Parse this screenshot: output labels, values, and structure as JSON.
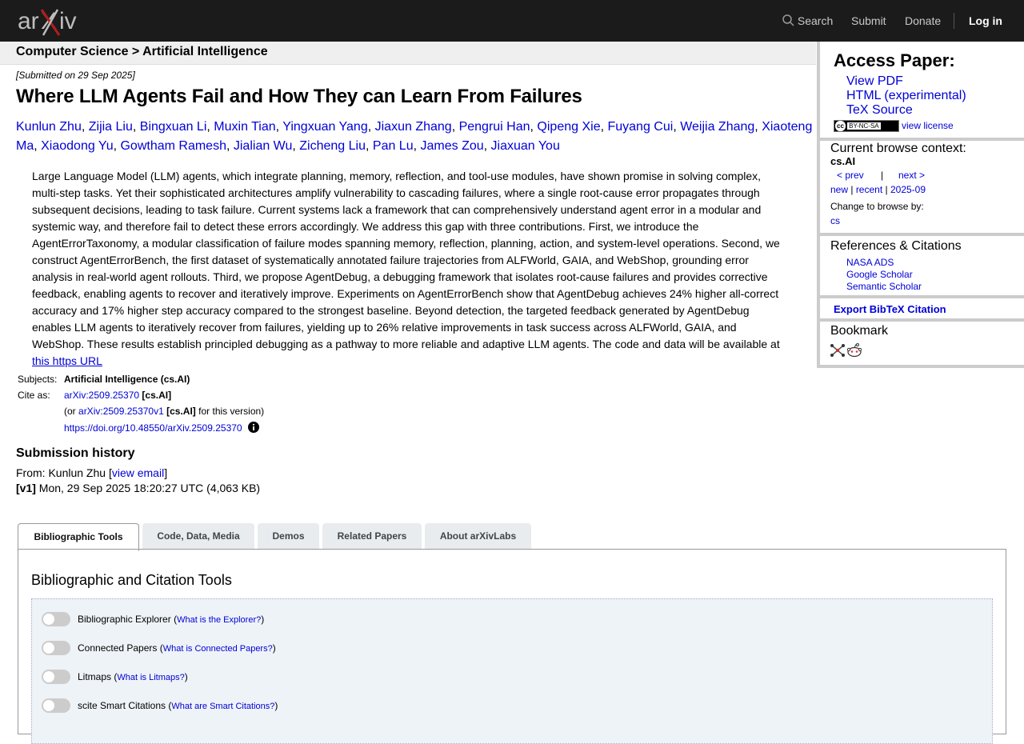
{
  "header": {
    "logo_text": "arXiv",
    "nav": {
      "search": "Search",
      "submit": "Submit",
      "donate": "Donate",
      "login": "Log in"
    }
  },
  "breadcrumb": "Computer Science > Artificial Intelligence",
  "paper": {
    "submitted": "[Submitted on 29 Sep 2025]",
    "title": "Where LLM Agents Fail and How They can Learn From Failures",
    "authors": [
      "Kunlun Zhu",
      "Zijia Liu",
      "Bingxuan Li",
      "Muxin Tian",
      "Yingxuan Yang",
      "Jiaxun Zhang",
      "Pengrui Han",
      "Qipeng Xie",
      "Fuyang Cui",
      "Weijia Zhang",
      "Xiaoteng Ma",
      "Xiaodong Yu",
      "Gowtham Ramesh",
      "Jialian Wu",
      "Zicheng Liu",
      "Pan Lu",
      "James Zou",
      "Jiaxuan You"
    ],
    "abstract": "Large Language Model (LLM) agents, which integrate planning, memory, reflection, and tool-use modules, have shown promise in solving complex, multi-step tasks. Yet their sophisticated architectures amplify vulnerability to cascading failures, where a single root-cause error propagates through subsequent decisions, leading to task failure. Current systems lack a framework that can comprehensively understand agent error in a modular and systemic way, and therefore fail to detect these errors accordingly. We address this gap with three contributions. First, we introduce the AgentErrorTaxonomy, a modular classification of failure modes spanning memory, reflection, planning, action, and system-level operations. Second, we construct AgentErrorBench, the first dataset of systematically annotated failure trajectories from ALFWorld, GAIA, and WebShop, grounding error analysis in real-world agent rollouts. Third, we propose AgentDebug, a debugging framework that isolates root-cause failures and provides corrective feedback, enabling agents to recover and iteratively improve. Experiments on AgentErrorBench show that AgentDebug achieves 24% higher all-correct accuracy and 17% higher step accuracy compared to the strongest baseline. Beyond detection, the targeted feedback generated by AgentDebug enables LLM agents to iteratively recover from failures, yielding up to 26% relative improvements in task success across ALFWorld, GAIA, and WebShop. These results establish principled debugging as a pathway to more reliable and adaptive LLM agents. The code and data will be available at",
    "abstract_link": "this https URL",
    "subjects_label": "Subjects:",
    "subjects": "Artificial Intelligence (cs.AI)",
    "cite_label": "Cite as:",
    "cite_id": "arXiv:2509.25370",
    "cite_cat": "[cs.AI]",
    "cite_or": "(or",
    "cite_v1": "arXiv:2509.25370v1",
    "cite_v1_cat": "[cs.AI]",
    "cite_v1_suffix": "for this version)",
    "doi": "https://doi.org/10.48550/arXiv.2509.25370"
  },
  "history": {
    "title": "Submission history",
    "from_prefix": "From: Kunlun Zhu [",
    "view_email": "view email",
    "from_suffix": "]",
    "v1_tag": "[v1]",
    "v1_text": "Mon, 29 Sep 2025 18:20:27 UTC (4,063 KB)"
  },
  "sidebar": {
    "access_title": "Access Paper:",
    "links": [
      "View PDF",
      "HTML (experimental)",
      "TeX Source"
    ],
    "license_badge": "BY-NC-SA",
    "view_license": "view license",
    "context_title": "Current browse context:",
    "context_value": "cs.AI",
    "prev": "< prev",
    "sep": "|",
    "next": "next >",
    "new": "new",
    "recent": "recent",
    "month": "2025-09",
    "change_browse": "Change to browse by:",
    "browse_cs": "cs",
    "refs_title": "References & Citations",
    "refs": [
      "NASA ADS",
      "Google Scholar",
      "Semantic Scholar"
    ],
    "export_bibtex": "Export BibTeX Citation",
    "bookmark_title": "Bookmark"
  },
  "tabs": [
    "Bibliographic Tools",
    "Code, Data, Media",
    "Demos",
    "Related Papers",
    "About arXivLabs"
  ],
  "tools": {
    "heading": "Bibliographic and Citation Tools",
    "items": [
      {
        "label": "Bibliographic Explorer",
        "help": "What is the Explorer?"
      },
      {
        "label": "Connected Papers",
        "help": "What is Connected Papers?"
      },
      {
        "label": "Litmaps",
        "help": "What is Litmaps?"
      },
      {
        "label": "scite Smart Citations",
        "help": "What are Smart Citations?"
      }
    ]
  },
  "colors": {
    "header_bg": "#1b1b1b",
    "logo_red": "#b31b1b",
    "link": "#0000d6"
  }
}
